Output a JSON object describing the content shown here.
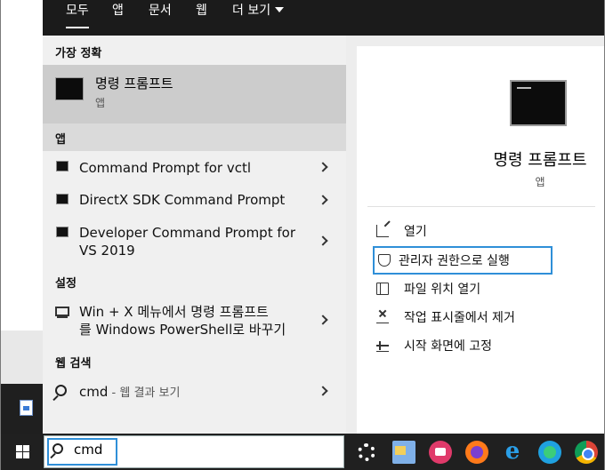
{
  "tabs": [
    {
      "label": "모두"
    },
    {
      "label": "앱"
    },
    {
      "label": "문서"
    },
    {
      "label": "웹"
    },
    {
      "label": "더 보기"
    }
  ],
  "best_match": {
    "heading": "가장 정확",
    "title": "명령 프롬프트",
    "subtitle": "앱"
  },
  "apps": {
    "heading": "앱",
    "items": [
      {
        "label": "Command Prompt for vctl"
      },
      {
        "label": "DirectX SDK Command Prompt"
      },
      {
        "label": "Developer Command Prompt for",
        "label2": "VS 2019"
      }
    ]
  },
  "settings": {
    "heading": "설정",
    "items": [
      {
        "label": "Win + X 메뉴에서 명령 프롬프트",
        "label2": "를 Windows PowerShell로 바꾸기"
      }
    ]
  },
  "web": {
    "heading": "웹 검색",
    "query": "cmd",
    "hint": " - 웹 결과 보기"
  },
  "detail": {
    "title": "명령 프롬프트",
    "subtitle": "앱",
    "actions": [
      {
        "label": "열기",
        "icon": "open-icon"
      },
      {
        "label": "관리자 권한으로 실행",
        "icon": "shield-icon"
      },
      {
        "label": "파일 위치 열기",
        "icon": "folder-icon"
      },
      {
        "label": "작업 표시줄에서 제거",
        "icon": "unpin-icon"
      },
      {
        "label": "시작 화면에 고정",
        "icon": "pin-icon"
      }
    ]
  },
  "taskbar": {
    "search_value": "cmd",
    "apps": [
      "settings-icon",
      "explorer-icon",
      "cast-icon",
      "firefox-icon",
      "internet-explorer-icon",
      "edge-icon",
      "chrome-icon"
    ]
  },
  "colors": {
    "topbar": "#1b1b1b",
    "selection_accent": "#2f8fd8",
    "best_match_bg": "#cccccc",
    "taskbar": "#202020"
  }
}
